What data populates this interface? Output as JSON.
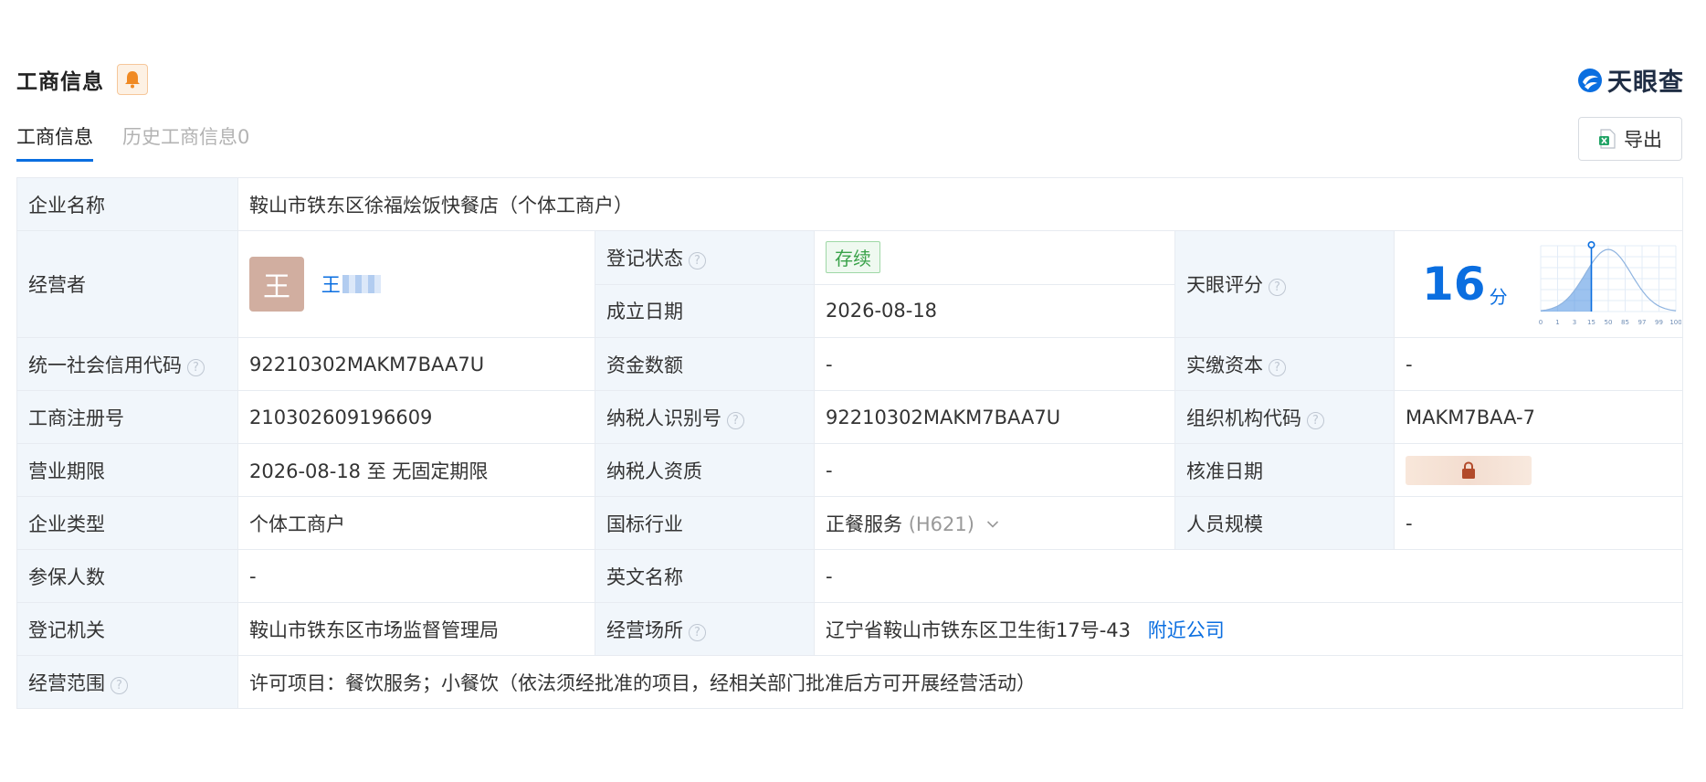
{
  "header": {
    "title": "工商信息",
    "brand": "天眼查"
  },
  "tabs": [
    {
      "label": "工商信息",
      "active": true
    },
    {
      "label": "历史工商信息0",
      "active": false
    }
  ],
  "export_label": "导出",
  "colors": {
    "accent": "#0a6ee0",
    "key_bg": "#f1f6fb",
    "status_green": "#3aa24a",
    "bell_orange": "#f08a24"
  },
  "company": {
    "name_label": "企业名称",
    "name": "鞍山市铁东区徐福烩饭快餐店（个体工商户）",
    "operator_label": "经营者",
    "operator_avatar": "王",
    "operator_name": "王",
    "status_label": "登记状态",
    "status": "存续",
    "established_label": "成立日期",
    "established": "2026-08-18",
    "score_label": "天眼评分",
    "score": "16",
    "score_unit": "分",
    "credit_code_label": "统一社会信用代码",
    "credit_code": "92210302MAKM7BAA7U",
    "capital_label": "资金数额",
    "capital": "-",
    "paid_in_label": "实缴资本",
    "paid_in": "-",
    "reg_no_label": "工商注册号",
    "reg_no": "210302609196609",
    "taxpayer_id_label": "纳税人识别号",
    "taxpayer_id": "92210302MAKM7BAA7U",
    "org_code_label": "组织机构代码",
    "org_code": "MAKM7BAA-7",
    "term_label": "营业期限",
    "term": "2026-08-18 至 无固定期限",
    "taxpayer_qual_label": "纳税人资质",
    "taxpayer_qual": "-",
    "approve_date_label": "核准日期",
    "type_label": "企业类型",
    "type": "个体工商户",
    "industry_label": "国标行业",
    "industry": "正餐服务",
    "industry_code": "(H621)",
    "staff_label": "人员规模",
    "staff": "-",
    "insured_label": "参保人数",
    "insured": "-",
    "english_name_label": "英文名称",
    "english_name": "-",
    "authority_label": "登记机关",
    "authority": "鞍山市铁东区市场监督管理局",
    "address_label": "经营场所",
    "address": "辽宁省鞍山市铁东区卫生街17号-43",
    "nearby_link": "附近公司",
    "scope_label": "经营范围",
    "scope": "许可项目：餐饮服务；小餐饮（依法须经批准的项目，经相关部门批准后方可开展经营活动）"
  },
  "chart_data": {
    "type": "area",
    "x": [
      "0",
      "1",
      "3",
      "15",
      "50",
      "85",
      "97",
      "99",
      "100"
    ],
    "marker": "15",
    "grid": true
  }
}
